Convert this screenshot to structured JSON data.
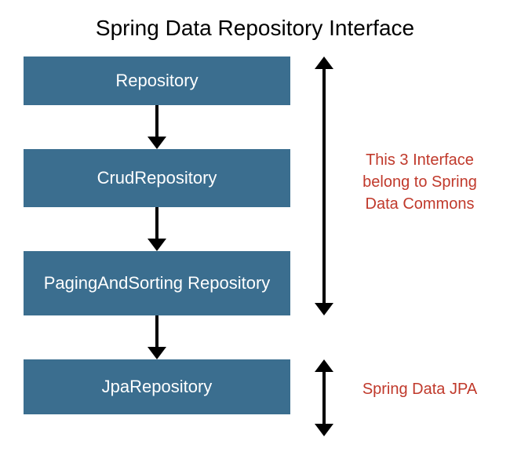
{
  "title": "Spring Data Repository Interface",
  "boxes": {
    "b1": "Repository",
    "b2": "CrudRepository",
    "b3": "PagingAndSorting Repository",
    "b4": "JpaRepository"
  },
  "annotations": {
    "a1": "This 3 Interface belong to Spring Data Commons",
    "a2": "Spring Data JPA"
  }
}
